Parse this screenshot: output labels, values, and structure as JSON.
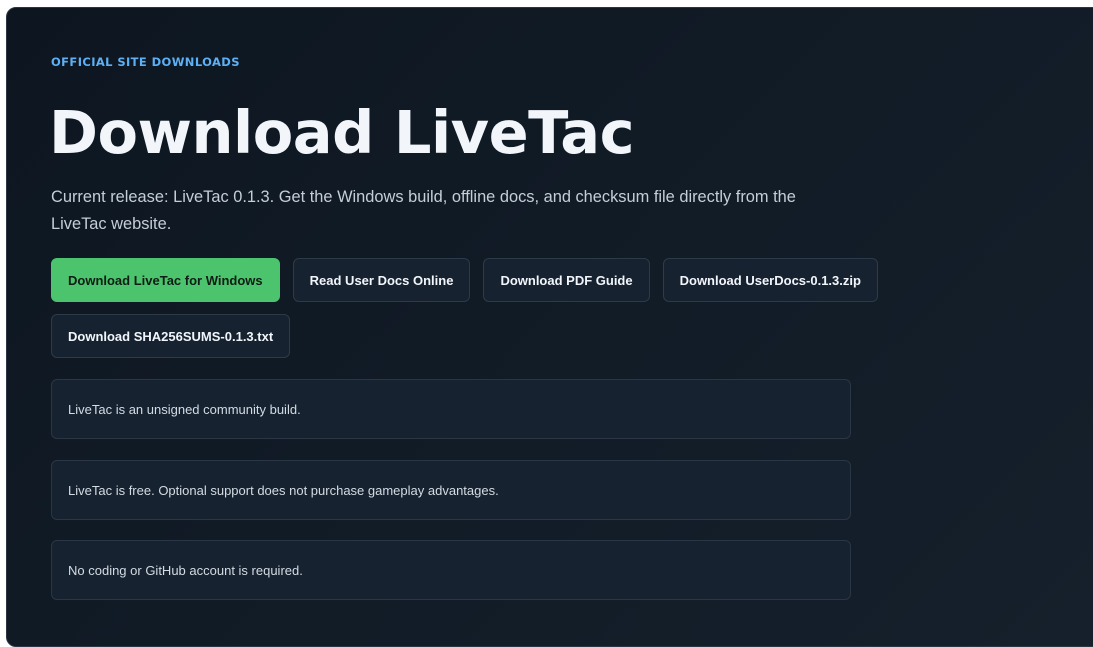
{
  "hero": {
    "eyebrow": "OFFICIAL SITE DOWNLOADS",
    "title": "Download LiveTac",
    "lede": "Current release: LiveTac 0.1.3. Get the Windows build, offline docs, and checksum file directly from the LiveTac website."
  },
  "buttons": [
    {
      "label": "Download LiveTac for Windows",
      "style": "primary"
    },
    {
      "label": "Read User Docs Online",
      "style": "secondary"
    },
    {
      "label": "Download PDF Guide",
      "style": "secondary"
    },
    {
      "label": "Download UserDocs-0.1.3.zip",
      "style": "secondary"
    },
    {
      "label": "Download SHA256SUMS-0.1.3.txt",
      "style": "secondary"
    }
  ],
  "notes": [
    "LiveTac is an unsigned community build.",
    "LiveTac is free. Optional support does not purchase gameplay advantages.",
    "No coding or GitHub account is required."
  ],
  "colors": {
    "accent": "#5db0f5",
    "primary_button": "#4cc46e",
    "background": "#0d1620"
  }
}
